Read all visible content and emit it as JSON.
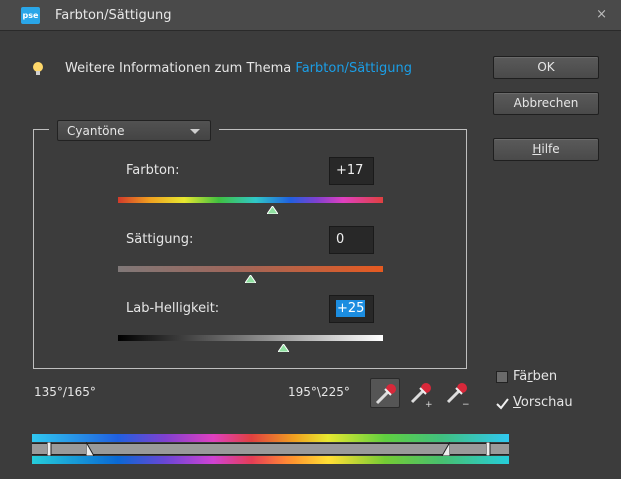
{
  "window": {
    "title": "Farbton/Sättigung",
    "app_icon": "pse",
    "close_glyph": "×"
  },
  "info": {
    "text": "Weitere Informationen zum Thema ",
    "link": "Farbton/Sättigung"
  },
  "buttons": {
    "ok": "OK",
    "cancel": "Abbrechen",
    "help_prefix": "",
    "help_underlined": "H",
    "help_rest": "ilfe"
  },
  "dropdown": {
    "selected": "Cyantöne"
  },
  "sliders": {
    "hue": {
      "label": "Farbton:",
      "value": "+17"
    },
    "saturation": {
      "label": "Sättigung:",
      "value": "0"
    },
    "lightness": {
      "label": "Lab-Helligkeit:",
      "value": "+25"
    }
  },
  "range": {
    "left": "135°/165°",
    "right": "195°\\225°"
  },
  "checkboxes": {
    "colorize": {
      "before": "Fä",
      "underlined": "r",
      "after": "ben",
      "checked": false
    },
    "preview": {
      "before": "",
      "underlined": "V",
      "after": "orschau",
      "checked": true
    }
  },
  "colors": {
    "background": "#3c3c3c",
    "link": "#1b9ee6",
    "selection": "#1c8de0"
  },
  "icons": [
    "lightbulb-icon",
    "eyedropper-icon",
    "eyedropper-plus-icon",
    "eyedropper-minus-icon",
    "check-icon",
    "close-icon"
  ]
}
